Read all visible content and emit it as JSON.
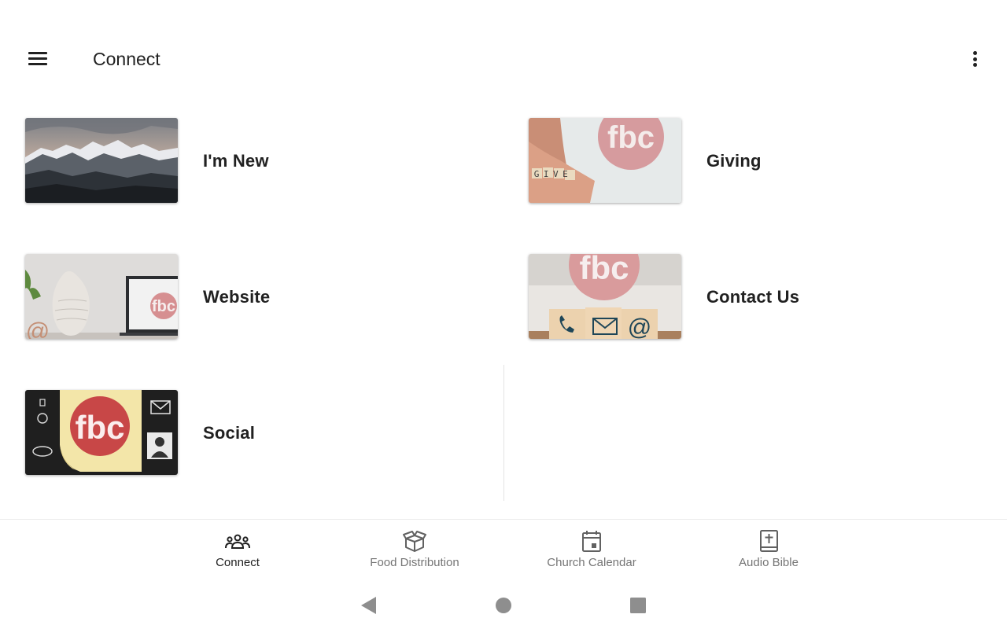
{
  "app_bar": {
    "title": "Connect",
    "menu_icon": "hamburger-menu-icon",
    "overflow_icon": "more-vert-icon"
  },
  "tiles": [
    {
      "label": "I'm New",
      "image": "mountain-range-photo"
    },
    {
      "label": "Giving",
      "image": "hands-give-fbc-photo"
    },
    {
      "label": "Website",
      "image": "vase-laptop-fbc-photo"
    },
    {
      "label": "Contact Us",
      "image": "contact-blocks-fbc-photo"
    },
    {
      "label": "Social",
      "image": "sticky-note-fbc-photo"
    }
  ],
  "thumbnail_text": {
    "logo": "fbc",
    "give_word": "GIVE",
    "at_symbol": "@"
  },
  "bottom_nav": {
    "items": [
      {
        "label": "Connect",
        "icon": "groups-icon",
        "active": true
      },
      {
        "label": "Food Distribution",
        "icon": "open-box-icon",
        "active": false
      },
      {
        "label": "Church Calendar",
        "icon": "calendar-icon",
        "active": false
      },
      {
        "label": "Audio Bible",
        "icon": "bible-book-icon",
        "active": false
      }
    ]
  },
  "system_nav": {
    "back_icon": "back-triangle-icon",
    "home_icon": "home-circle-icon",
    "recents_icon": "recents-square-icon"
  },
  "colors": {
    "text_primary": "#212121",
    "text_secondary": "#757575",
    "brand_fbc": "#c0504d",
    "divider": "#e3e3e3"
  }
}
